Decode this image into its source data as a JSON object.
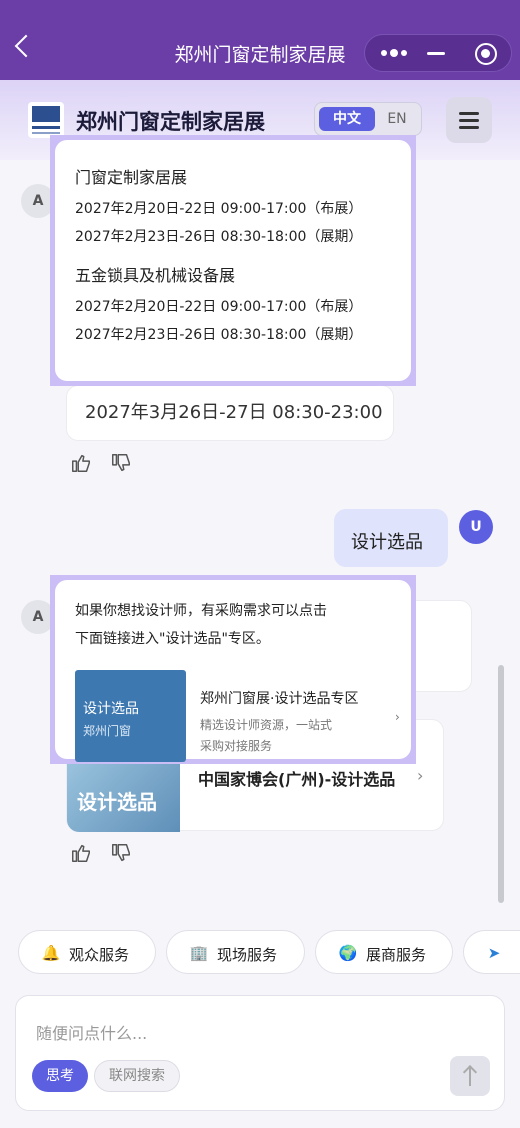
{
  "nav": {
    "title": "郑州门窗定制家居展"
  },
  "header": {
    "brand": "郑州门窗定制家居展",
    "lang_active": "中文",
    "lang_other": "EN"
  },
  "avatars": {
    "assistant": "A",
    "user": "U"
  },
  "chat": {
    "schedule": {
      "section1_title": "门窗定制家居展",
      "section1_lines": [
        "2027年2月20日-22日 09:00-17:00（布展）",
        "2027年2月23日-26日 08:30-18:00（展期）"
      ],
      "section2_title": "五金锁具及机械设备展",
      "section2_lines": [
        "2027年2月20日-22日 09:00-17:00（布展）",
        "2027年2月23日-26日 08:30-18:00（展期）"
      ]
    },
    "underlying_date": "2027年3月26日-27日 08:30-23:00",
    "user_message": "设计选品",
    "design_reply": {
      "intro_lines": [
        "如果你想找设计师，有采购需求可以点击",
        "下面链接进入\"设计选品\"专区。"
      ],
      "link_image_title": "设计选品",
      "link_image_sub": "郑州门窗",
      "link_title": "郑州门窗展·设计选品专区",
      "link_desc_lines": [
        "精选设计师资源，一站式",
        "采购对接服务"
      ],
      "link_arrow": "›"
    },
    "underlying_card": {
      "image_text": "设计选品",
      "title": "中国家博会(广州)-设计选品",
      "arrow": "›"
    }
  },
  "quick_services": [
    {
      "label": "观众服务",
      "icon": "bell-icon",
      "glyph": "🔔"
    },
    {
      "label": "现场服务",
      "icon": "building-icon",
      "glyph": "🏢"
    },
    {
      "label": "展商服务",
      "icon": "globe-icon",
      "glyph": "🌍"
    }
  ],
  "input": {
    "placeholder": "随便问点什么...",
    "think_label": "思考",
    "search_label": "联网搜索"
  }
}
